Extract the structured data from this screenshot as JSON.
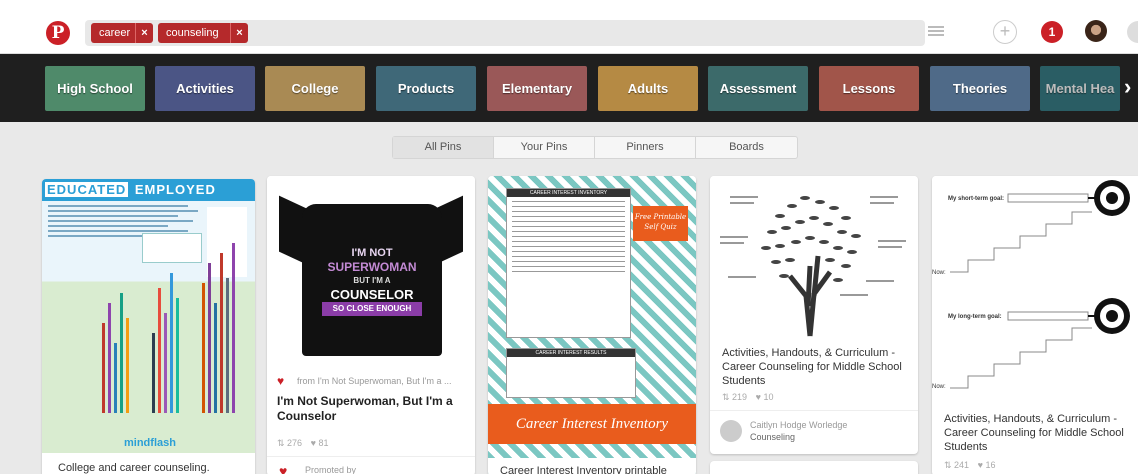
{
  "header": {
    "logo": "P",
    "search_tags": [
      {
        "label": "career"
      },
      {
        "label": "counseling"
      }
    ],
    "notification_count": "1"
  },
  "guided_search": {
    "chips": [
      {
        "label": "High School",
        "color": "#4f8a6a"
      },
      {
        "label": "Activities",
        "color": "#4b5585"
      },
      {
        "label": "College",
        "color": "#a98a54"
      },
      {
        "label": "Products",
        "color": "#3f6878"
      },
      {
        "label": "Elementary",
        "color": "#9a5858"
      },
      {
        "label": "Adults",
        "color": "#b58a44"
      },
      {
        "label": "Assessment",
        "color": "#3c6a6a"
      },
      {
        "label": "Lessons",
        "color": "#a1554a"
      },
      {
        "label": "Theories",
        "color": "#4f6a88"
      },
      {
        "label": "Mental Hea",
        "color": "#2f7882"
      }
    ]
  },
  "tabs": [
    {
      "label": "All Pins",
      "active": true
    },
    {
      "label": "Your Pins",
      "active": false
    },
    {
      "label": "Pinners",
      "active": false
    },
    {
      "label": "Boards",
      "active": false
    }
  ],
  "pins": {
    "infographic": {
      "title_left": "EDUCATED",
      "title_right": "EMPLOYED",
      "brand": "mindflash",
      "description": "College and career counseling."
    },
    "shirt": {
      "shirt_lines": [
        "I'M NOT",
        "SUPERWOMAN",
        "BUT I'M A",
        "COUNSELOR",
        "SO CLOSE ENOUGH"
      ],
      "via": "from I'm Not Superwoman, But I'm a ...",
      "title": "I'm Not Superwoman, But I'm a Counselor",
      "repins": "276",
      "likes": "81",
      "promoted": "Promoted by"
    },
    "inventory": {
      "doc_title": "CAREER INTEREST INVENTORY",
      "doc2_title": "CAREER INTEREST RESULTS",
      "tag": "Free Printable Self Quiz",
      "band": "Career Interest Inventory",
      "description": "Career Interest Inventory printable"
    },
    "tree": {
      "title": "Activities, Handouts, & Curriculum - Career Counseling for Middle School Students",
      "repins": "219",
      "likes": "10",
      "pinner": "Caitlyn Hodge Worledge",
      "board": "Counseling"
    },
    "goals": {
      "short_goal": "My short-term goal:",
      "long_goal": "My long-term goal:",
      "now_label": "Now:",
      "title": "Activities, Handouts, & Curriculum - Career Counseling for Middle School Students",
      "repins": "241",
      "likes": "16"
    }
  }
}
